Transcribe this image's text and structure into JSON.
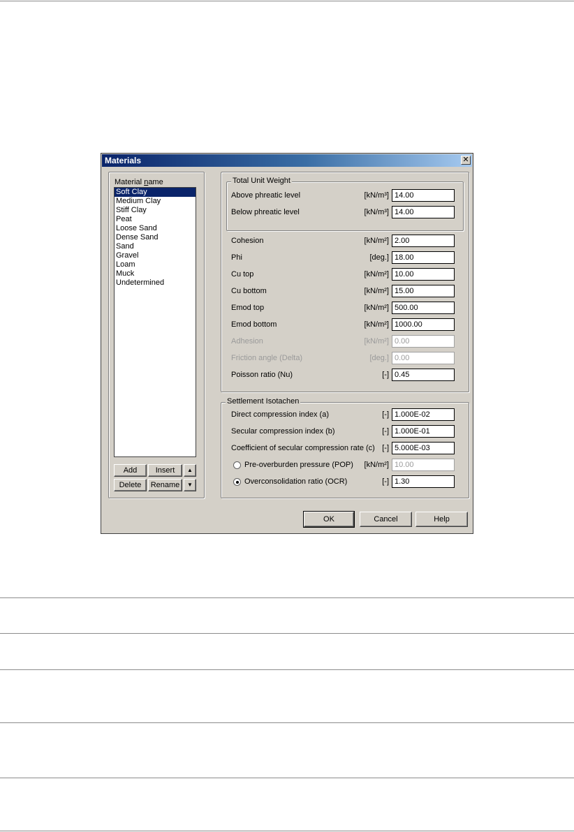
{
  "dialog": {
    "title": "Materials",
    "close_symbol": "✕"
  },
  "materials": {
    "label": "Material name",
    "items": [
      "Soft Clay",
      "Medium Clay",
      "Stiff Clay",
      "Peat",
      "Loose Sand",
      "Dense Sand",
      "Sand",
      "Gravel",
      "Loam",
      "Muck",
      "Undetermined"
    ],
    "selected": "Soft Clay",
    "buttons": {
      "add": "Add",
      "insert": "Insert",
      "delete": "Delete",
      "rename": "Rename",
      "up": "▲",
      "down": "▼"
    }
  },
  "unit_weight": {
    "group_label": "Total Unit Weight",
    "rows": [
      {
        "label": "Above phreatic level",
        "unit": "[kN/m³]",
        "value": "14.00"
      },
      {
        "label": "Below phreatic level",
        "unit": "[kN/m³]",
        "value": "14.00"
      }
    ]
  },
  "parameters": {
    "rows": [
      {
        "label": "Cohesion",
        "unit": "[kN/m²]",
        "value": "2.00",
        "enabled": true
      },
      {
        "label": "Phi",
        "unit": "[deg.]",
        "value": "18.00",
        "enabled": true
      },
      {
        "label": "Cu top",
        "unit": "[kN/m²]",
        "value": "10.00",
        "enabled": true
      },
      {
        "label": "Cu bottom",
        "unit": "[kN/m²]",
        "value": "15.00",
        "enabled": true
      },
      {
        "label": "Emod top",
        "unit": "[kN/m²]",
        "value": "500.00",
        "enabled": true
      },
      {
        "label": "Emod bottom",
        "unit": "[kN/m²]",
        "value": "1000.00",
        "enabled": true
      },
      {
        "label": "Adhesion",
        "unit": "[kN/m²]",
        "value": "0.00",
        "enabled": false
      },
      {
        "label": "Friction angle (Delta)",
        "unit": "[deg.]",
        "value": "0.00",
        "enabled": false
      },
      {
        "label": "Poisson ratio (Nu)",
        "unit": "[-]",
        "value": "0.45",
        "enabled": true
      }
    ]
  },
  "isotachen": {
    "group_label": "Settlement Isotachen",
    "rows": [
      {
        "label": "Direct compression index (a)",
        "unit": "[-]",
        "value": "1.000E-02",
        "enabled": true
      },
      {
        "label": "Secular compression index (b)",
        "unit": "[-]",
        "value": "1.000E-01",
        "enabled": true
      },
      {
        "label": "Coefficient of secular compression rate (c)",
        "unit": "[-]",
        "value": "5.000E-03",
        "enabled": true
      }
    ],
    "pop": {
      "label": "Pre-overburden pressure (POP)",
      "unit": "[kN/m²]",
      "value": "10.00",
      "checked": false
    },
    "ocr": {
      "label": "Overconsolidation ratio (OCR)",
      "unit": "[-]",
      "value": "1.30",
      "checked": true
    }
  },
  "footer": {
    "ok": "OK",
    "cancel": "Cancel",
    "help": "Help"
  }
}
